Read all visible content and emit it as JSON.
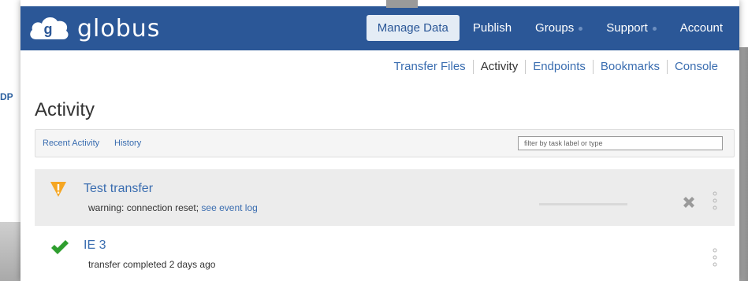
{
  "backdrop": {
    "partial_text": "DP"
  },
  "brand": {
    "name": "globus",
    "mark_letter": "g"
  },
  "nav": {
    "items": [
      {
        "label": "Manage Data",
        "active": true,
        "has_caret": false
      },
      {
        "label": "Publish",
        "active": false,
        "has_caret": false
      },
      {
        "label": "Groups",
        "active": false,
        "has_caret": true
      },
      {
        "label": "Support",
        "active": false,
        "has_caret": true
      },
      {
        "label": "Account",
        "active": false,
        "has_caret": false
      }
    ]
  },
  "subnav": {
    "items": [
      "Transfer Files",
      "Activity",
      "Endpoints",
      "Bookmarks",
      "Console"
    ],
    "current": "Activity"
  },
  "page": {
    "title": "Activity"
  },
  "tabs": {
    "recent": "Recent Activity",
    "history": "History"
  },
  "filter": {
    "placeholder": "filter by task label or type"
  },
  "tasks": [
    {
      "title": "Test transfer",
      "status": "warning",
      "status_icon": "warning-icon",
      "subtitle_prefix": "warning: connection reset; ",
      "subtitle_link": "see event log",
      "progress": 0,
      "cancellable": true
    },
    {
      "title": "IE 3",
      "status": "succeeded",
      "status_icon": "check-icon",
      "subtitle_prefix": "transfer completed 2 days ago",
      "subtitle_link": "",
      "cancellable": false
    }
  ],
  "colors": {
    "nav_bg": "#2b5797",
    "link": "#3a6db0",
    "warning": "#f5a623",
    "success": "#2e9e2e"
  }
}
